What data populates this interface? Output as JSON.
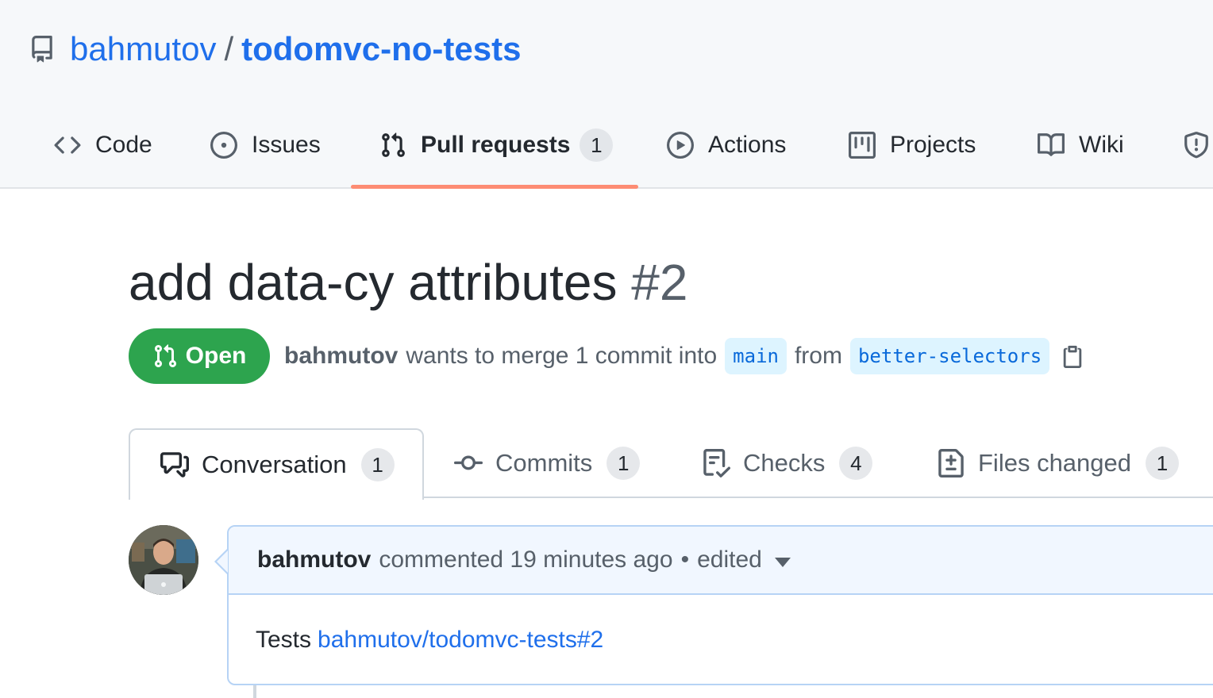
{
  "repo": {
    "owner": "bahmutov",
    "separator": "/",
    "name": "todomvc-no-tests"
  },
  "nav": {
    "items": [
      {
        "label": "Code",
        "icon": "code-icon"
      },
      {
        "label": "Issues",
        "icon": "issue-opened-icon"
      },
      {
        "label": "Pull requests",
        "icon": "git-pull-request-icon",
        "count": "1",
        "active": true
      },
      {
        "label": "Actions",
        "icon": "play-icon"
      },
      {
        "label": "Projects",
        "icon": "project-icon"
      },
      {
        "label": "Wiki",
        "icon": "book-icon"
      },
      {
        "label": "",
        "icon": "shield-icon"
      }
    ],
    "active_color": "#fd8c73"
  },
  "pr": {
    "title": "add data-cy attributes",
    "number": "#2",
    "state": "Open",
    "state_color": "#2da44e",
    "author": "bahmutov",
    "merge_text": "wants to merge 1 commit into",
    "base_branch": "main",
    "from_text": "from",
    "head_branch": "better-selectors"
  },
  "tabs": [
    {
      "label": "Conversation",
      "count": "1",
      "icon": "comment-discussion-icon",
      "active": true
    },
    {
      "label": "Commits",
      "count": "1",
      "icon": "git-commit-icon"
    },
    {
      "label": "Checks",
      "count": "4",
      "icon": "checklist-icon"
    },
    {
      "label": "Files changed",
      "count": "1",
      "icon": "file-diff-icon"
    }
  ],
  "comment": {
    "author": "bahmutov",
    "action": "commented 19 minutes ago",
    "separator": "•",
    "edited": "edited",
    "body_text": "Tests",
    "body_link": "bahmutov/todomvc-tests#2"
  },
  "colors": {
    "link": "#1f6feb",
    "header_bg": "#f6f8fa",
    "comment_header_bg": "#f1f7ff"
  }
}
